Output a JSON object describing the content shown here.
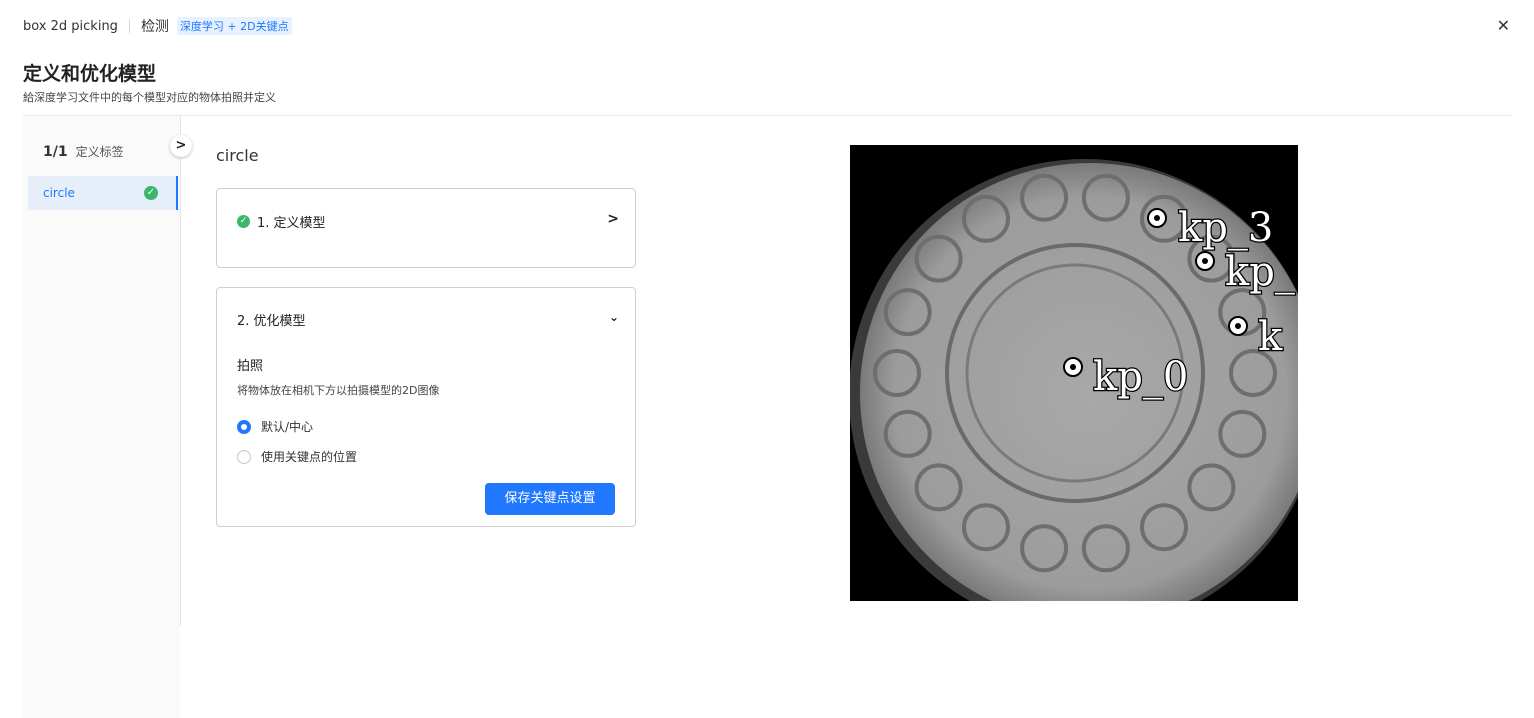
{
  "header": {
    "project_name": "box 2d picking",
    "mode": "检测",
    "mode_tag": "深度学习 + 2D关键点",
    "close_icon": "close-icon"
  },
  "page": {
    "title": "定义和优化模型",
    "subtitle": "給深度学习文件中的每个模型对应的物体拍照并定义"
  },
  "sidebar": {
    "count": "1/1",
    "label": "定义标签",
    "items": [
      {
        "label": "circle",
        "status": "done",
        "icon": "check-circle-icon"
      }
    ],
    "toggle_icon": "chevron-right-icon"
  },
  "main": {
    "model_name": "circle",
    "step1": {
      "label": "1. 定义模型",
      "status": "done",
      "icon": "chevron-right-icon"
    },
    "step2": {
      "label": "2. 优化模型",
      "icon": "chevron-down-icon",
      "section_title": "拍照",
      "section_desc": "将物体放在相机下方以拍摄模型的2D图像",
      "options": [
        {
          "label": "默认/中心",
          "selected": true
        },
        {
          "label": "使用关键点的位置",
          "selected": false
        }
      ],
      "save_button": "保存关键点设置"
    }
  },
  "preview": {
    "keypoints": [
      {
        "label": "kp_0"
      },
      {
        "label": "kp_3"
      },
      {
        "label": "kp_"
      },
      {
        "label": "k"
      }
    ]
  },
  "colors": {
    "accent": "#1f78ff",
    "success": "#3cb66a",
    "selected_bg": "#e6eefa"
  }
}
